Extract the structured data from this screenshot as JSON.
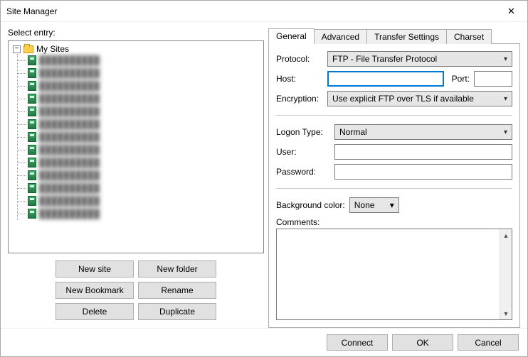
{
  "window": {
    "title": "Site Manager"
  },
  "left": {
    "label": "Select entry:",
    "root_label": "My Sites",
    "sites_count": 13,
    "buttons": {
      "new_site": "New site",
      "new_folder": "New folder",
      "new_bookmark": "New Bookmark",
      "rename": "Rename",
      "delete": "Delete",
      "duplicate": "Duplicate"
    }
  },
  "tabs": {
    "general": "General",
    "advanced": "Advanced",
    "transfer": "Transfer Settings",
    "charset": "Charset"
  },
  "form": {
    "protocol_label": "Protocol:",
    "protocol_value": "FTP - File Transfer Protocol",
    "host_label": "Host:",
    "port_label": "Port:",
    "encryption_label": "Encryption:",
    "encryption_value": "Use explicit FTP over TLS if available",
    "logon_type_label": "Logon Type:",
    "logon_type_value": "Normal",
    "user_label": "User:",
    "password_label": "Password:",
    "bgcolor_label": "Background color:",
    "bgcolor_value": "None",
    "comments_label": "Comments:"
  },
  "footer": {
    "connect": "Connect",
    "ok": "OK",
    "cancel": "Cancel"
  }
}
